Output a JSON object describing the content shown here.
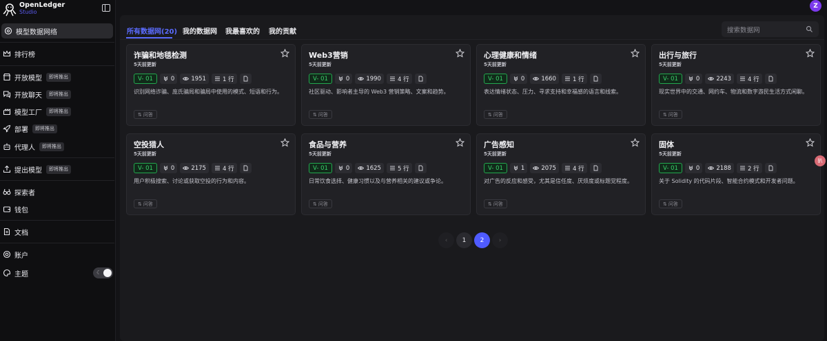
{
  "brand": {
    "name": "OpenLedger",
    "sub": "Studio"
  },
  "nav": {
    "data_network": "模型数据网络",
    "leaderboard": "排行榜",
    "open_model": "开放模型",
    "open_chat": "开放聊天",
    "model_factory": "模型工厂",
    "deploy": "部署",
    "agent": "代理人",
    "propose_model": "提出模型",
    "explorer": "探索者",
    "wallet": "钱包",
    "docs": "文档",
    "account": "账户",
    "theme": "主题",
    "soon_badge": "即将推出"
  },
  "user": {
    "avatar_initial": "Z"
  },
  "tabs": [
    "所有数据网(20)",
    "我的数据网",
    "我最喜欢的",
    "我的贡献"
  ],
  "search": {
    "placeholder": "搜索数据网"
  },
  "cards": [
    {
      "title": "诈骗和地毯检测",
      "updated": "5天前更新",
      "version": "V- 01",
      "likes": "0",
      "views": "1951",
      "rows": "1 行",
      "description": "识别网络诈骗、庞氏骗局和骗局中使用的模式、短语和行为。",
      "tag": "问答"
    },
    {
      "title": "Web3营销",
      "updated": "5天前更新",
      "version": "V- 01",
      "likes": "0",
      "views": "1990",
      "rows": "4 行",
      "description": "社区驱动、影响者主导的 Web3 营销策略、文案和趋势。",
      "tag": "问答"
    },
    {
      "title": "心理健康和情绪",
      "updated": "5天前更新",
      "version": "V- 01",
      "likes": "0",
      "views": "1660",
      "rows": "1 行",
      "description": "表达情绪状态、压力、寻求支持和幸福感的语言和线索。",
      "tag": "问答"
    },
    {
      "title": "出行与旅行",
      "updated": "5天前更新",
      "version": "V- 01",
      "likes": "0",
      "views": "2243",
      "rows": "4 行",
      "description": "现实世界中的交通、网约车、物流和数字游民生活方式闲聊。",
      "tag": "问答"
    },
    {
      "title": "空投猎人",
      "updated": "5天前更新",
      "version": "V- 01",
      "likes": "0",
      "views": "2175",
      "rows": "4 行",
      "description": "用户积极搜索、讨论或获取空投的行为和内容。",
      "tag": "问答"
    },
    {
      "title": "食品与营养",
      "updated": "5天前更新",
      "version": "V- 01",
      "likes": "0",
      "views": "1625",
      "rows": "5 行",
      "description": "日常饮食选择、健康习惯以及与营养相关的建议或争论。",
      "tag": "问答"
    },
    {
      "title": "广告感知",
      "updated": "5天前更新",
      "version": "V- 01",
      "likes": "1",
      "views": "2075",
      "rows": "4 行",
      "description": "对广告的反应和感受，尤其是信任度、厌烦度或标题党程度。",
      "tag": "问答"
    },
    {
      "title": "固体",
      "updated": "5天前更新",
      "version": "V- 01",
      "likes": "0",
      "views": "2188",
      "rows": "2 行",
      "description": "关于 Solidity 的代码片段、智能合约模式和开发者问题。",
      "tag": "问答"
    }
  ],
  "pagination": {
    "prev": "‹",
    "pages": [
      "1",
      "2"
    ],
    "next": "›",
    "current": "2"
  },
  "floating_badge": "扒"
}
